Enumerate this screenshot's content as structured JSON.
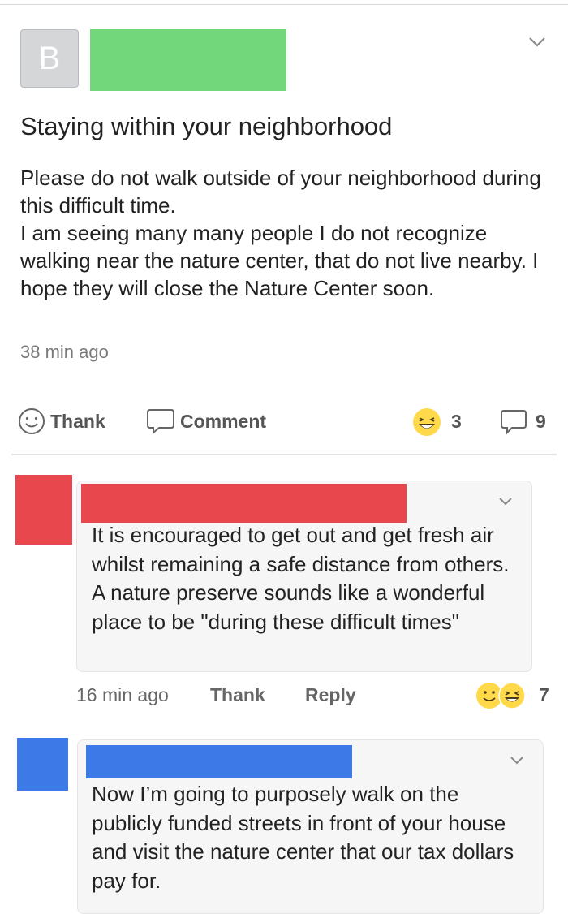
{
  "post": {
    "author_initial": "B",
    "title": "Staying within your neighborhood",
    "body": "Please do not walk outside of your neighborhood during this difficult time.\nI am seeing many many people I do not recognize walking near the nature center, that do not live nearby. I hope they will close the Nature Center soon.",
    "time": "38 min ago",
    "actions": {
      "thank": "Thank",
      "comment": "Comment"
    },
    "reaction_count": "3",
    "comment_count": "9"
  },
  "comments": [
    {
      "text": "It is encouraged to get out and get fresh air whilst remaining a safe distance from others. A nature preserve sounds like a wonderful place to be \"during these difficult times\"",
      "time": "16 min ago",
      "thank": "Thank",
      "reply": "Reply",
      "reaction_count": "7",
      "avatar_color": "#e8474e"
    },
    {
      "text": "Now I’m going to purposely walk on the publicly funded streets in front of your house and visit the nature center that our tax dollars pay for.",
      "avatar_color": "#3d7ae8"
    }
  ],
  "colors": {
    "author_redaction": "#72d67b",
    "red_redaction": "#e8474e",
    "blue_redaction": "#3d7ae8"
  }
}
